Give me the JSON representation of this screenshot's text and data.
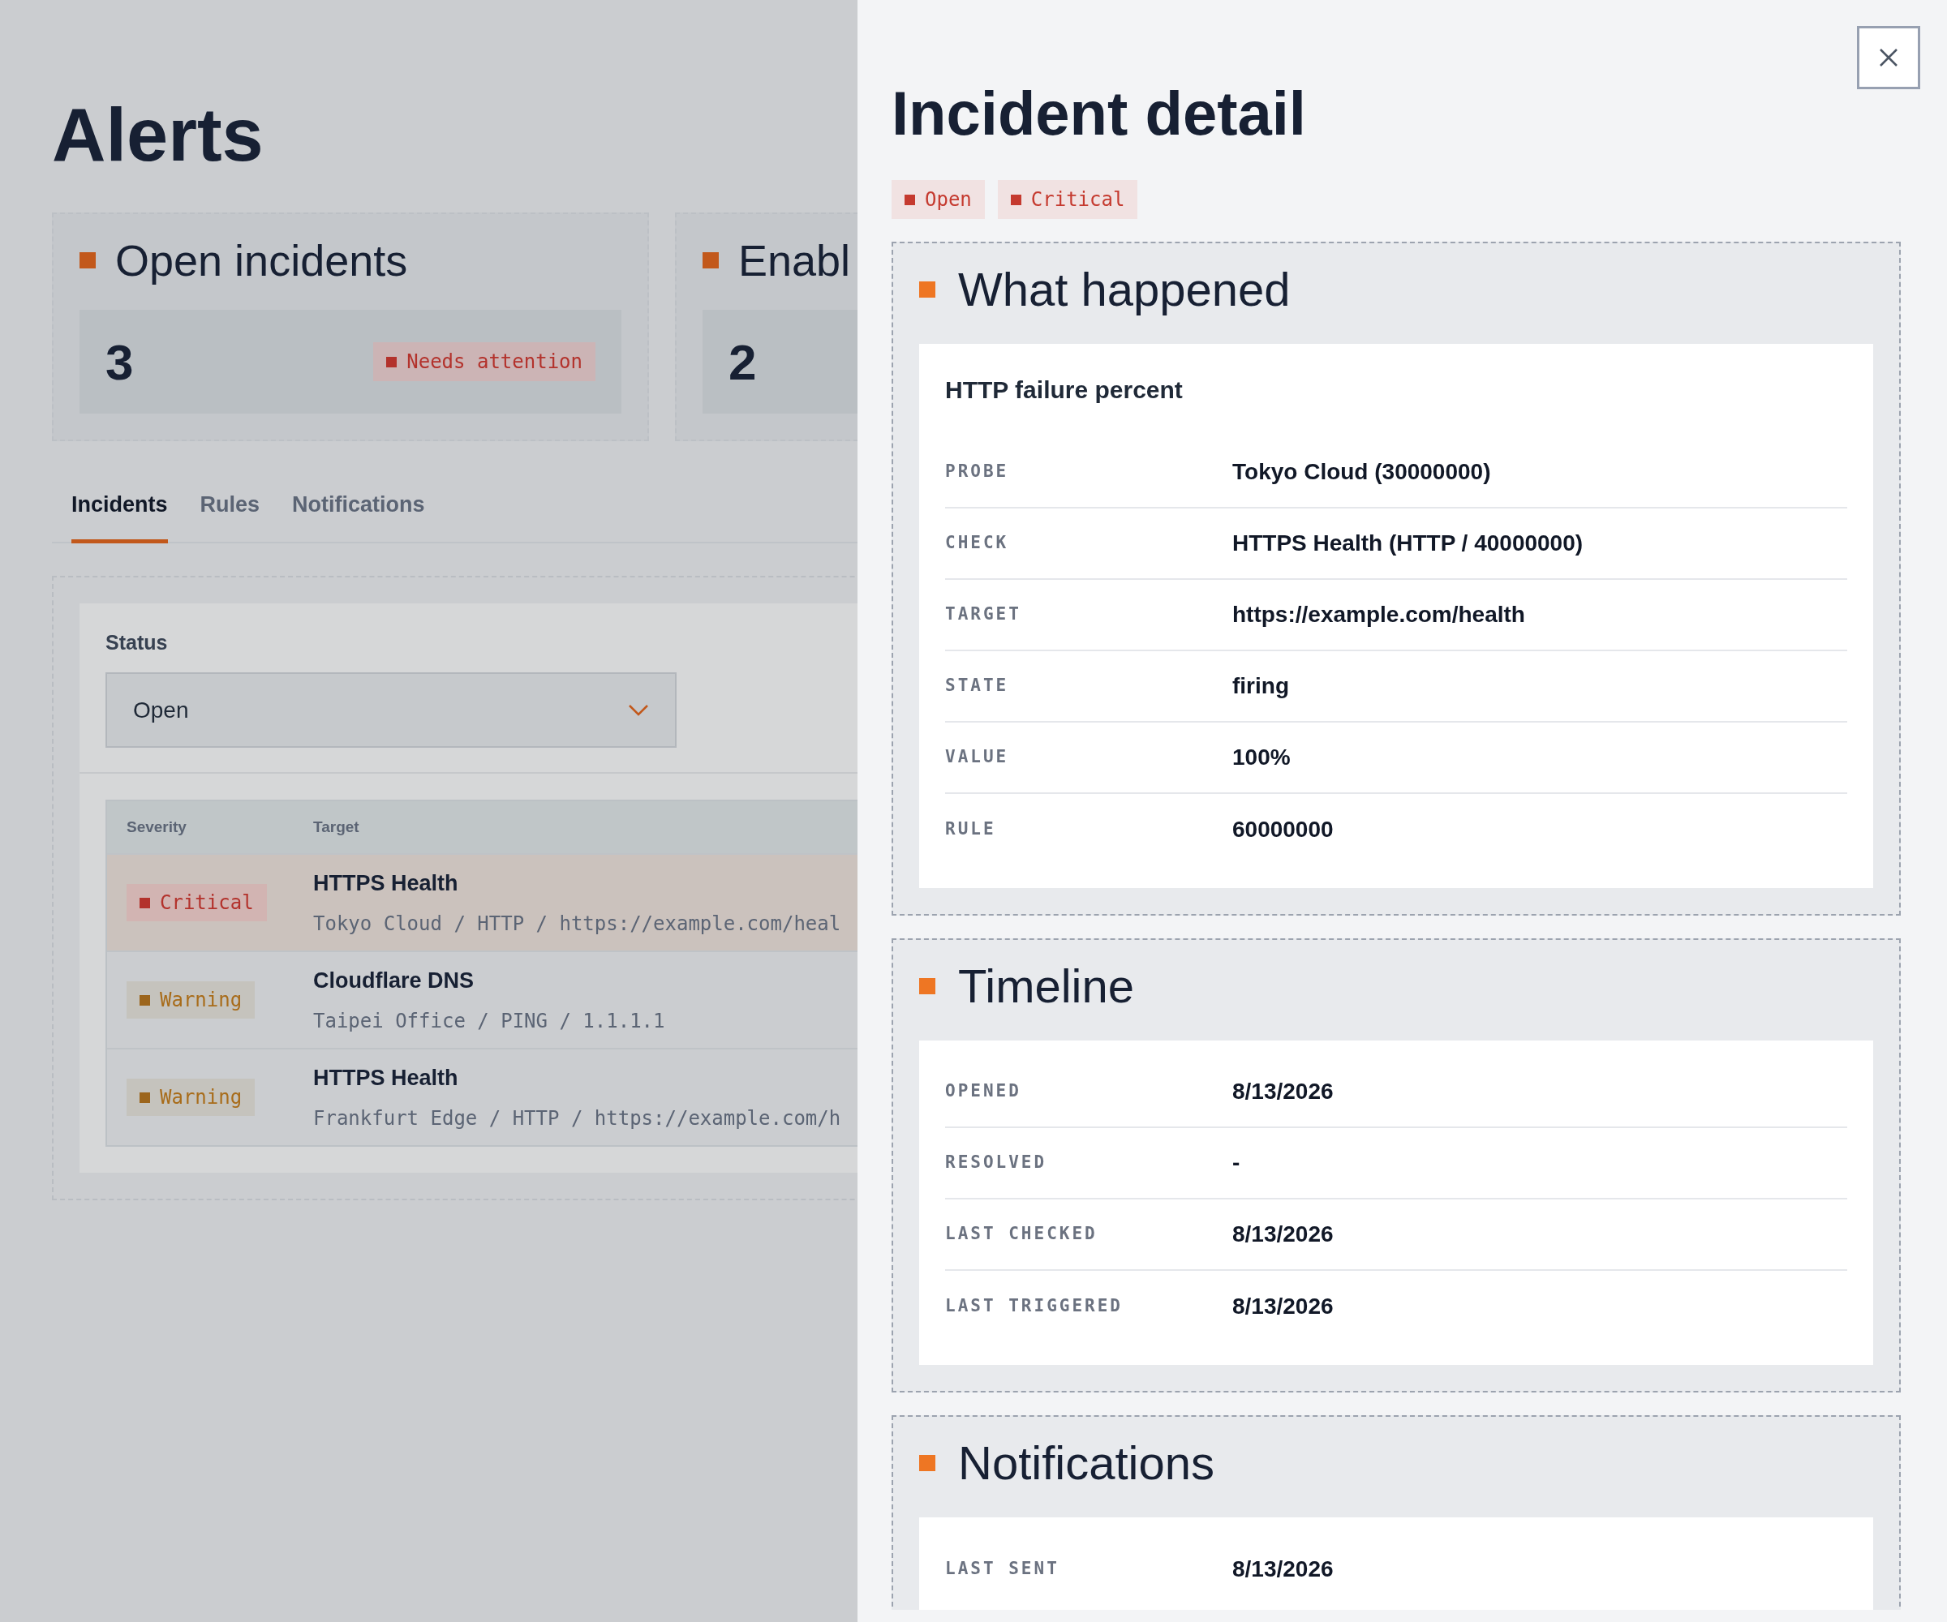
{
  "page": {
    "title": "Alerts"
  },
  "summary_cards": [
    {
      "title": "Open incidents",
      "value": "3",
      "badge": {
        "text": "Needs attention",
        "kind": "danger"
      }
    },
    {
      "title": "Enabl",
      "value": "2"
    }
  ],
  "tabs": [
    {
      "label": "Incidents",
      "selected": true
    },
    {
      "label": "Rules",
      "selected": false
    },
    {
      "label": "Notifications",
      "selected": false
    }
  ],
  "filter": {
    "label": "Status",
    "value": "Open"
  },
  "table": {
    "columns": [
      "Severity",
      "Target"
    ],
    "rows": [
      {
        "selected": true,
        "severity": {
          "text": "Critical",
          "kind": "critical"
        },
        "title": "HTTPS Health",
        "subtitle": "Tokyo Cloud / HTTP / https://example.com/heal"
      },
      {
        "selected": false,
        "severity": {
          "text": "Warning",
          "kind": "warning"
        },
        "title": "Cloudflare DNS",
        "subtitle": "Taipei Office / PING / 1.1.1.1"
      },
      {
        "selected": false,
        "severity": {
          "text": "Warning",
          "kind": "warning"
        },
        "title": "HTTPS Health",
        "subtitle": "Frankfurt Edge / HTTP / https://example.com/h"
      }
    ]
  },
  "drawer": {
    "title": "Incident detail",
    "badges": [
      {
        "text": "Open"
      },
      {
        "text": "Critical"
      }
    ],
    "sections": [
      {
        "title": "What happened",
        "heading": "HTTP failure percent",
        "fields": [
          {
            "label": "PROBE",
            "value": "Tokyo Cloud (30000000)"
          },
          {
            "label": "CHECK",
            "value": "HTTPS Health (HTTP / 40000000)"
          },
          {
            "label": "TARGET",
            "value": "https://example.com/health"
          },
          {
            "label": "STATE",
            "value": "firing"
          },
          {
            "label": "VALUE",
            "value": "100%"
          },
          {
            "label": "RULE",
            "value": "60000000"
          }
        ]
      },
      {
        "title": "Timeline",
        "fields": [
          {
            "label": "OPENED",
            "value": "8/13/2026"
          },
          {
            "label": "RESOLVED",
            "value": "-"
          },
          {
            "label": "LAST CHECKED",
            "value": "8/13/2026"
          },
          {
            "label": "LAST TRIGGERED",
            "value": "8/13/2026"
          }
        ]
      },
      {
        "title": "Notifications",
        "fields": [
          {
            "label": "LAST SENT",
            "value": "8/13/2026"
          }
        ]
      }
    ]
  }
}
